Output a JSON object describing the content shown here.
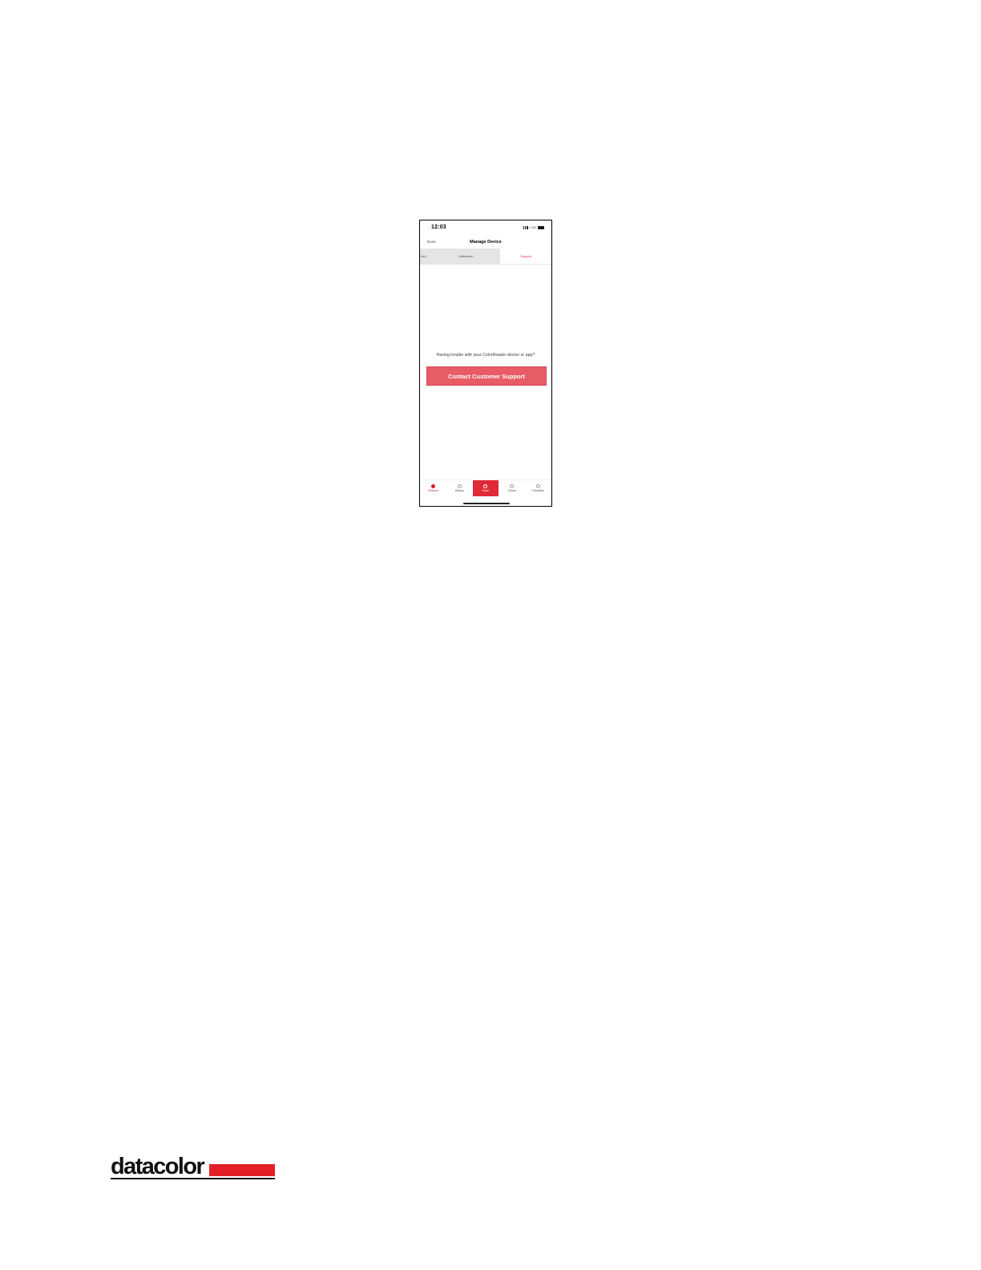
{
  "phone": {
    "status": {
      "time": "12:03",
      "network": "ıl 4G"
    },
    "nav": {
      "left": "Done",
      "title": "Manage Device"
    },
    "tabs": [
      {
        "label": "Info"
      },
      {
        "label": "Calibration"
      },
      {
        "label": "Support"
      }
    ],
    "help_text": "Having trouble with your ColorReader device or app?",
    "support_button": "Contact Customer Support",
    "tab_bar": [
      {
        "label": "Devices"
      },
      {
        "label": "History"
      },
      {
        "label": "Scan"
      },
      {
        "label": "Colors"
      },
      {
        "label": "Favorites"
      }
    ]
  },
  "brand": {
    "name": "datacolor",
    "accent": "#e41f26",
    "button_color": "#e85c66"
  }
}
